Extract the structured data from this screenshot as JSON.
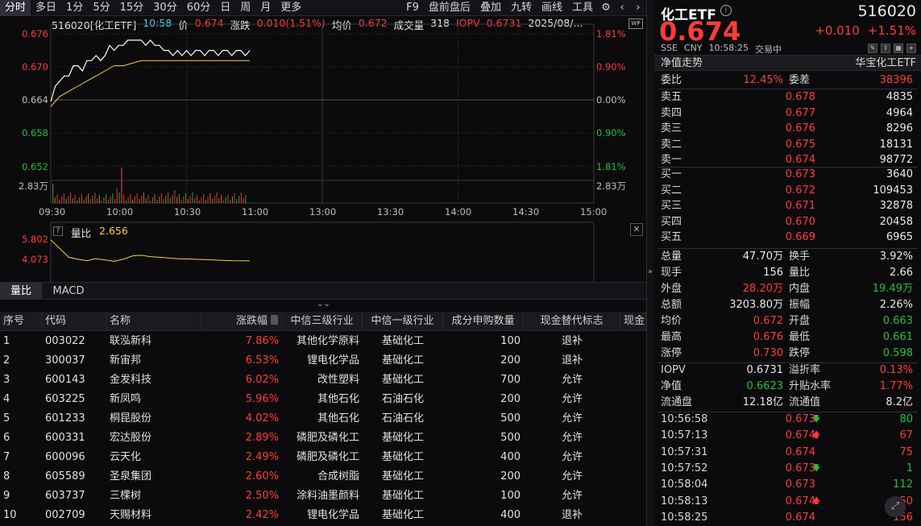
{
  "toolbar": {
    "items": [
      "分时",
      "多日",
      "1分",
      "5分",
      "15分",
      "30分",
      "60分",
      "日",
      "周",
      "月",
      "更多"
    ],
    "right_items": [
      "F9",
      "盘前盘后",
      "叠加",
      "九转",
      "画线",
      "工具"
    ]
  },
  "chart_header": {
    "code_name": "516020[化工ETF]",
    "time": "10:58",
    "price_label": "价",
    "price": "0.674",
    "change_label": "涨跌",
    "change": "0.010(1.51%)",
    "avg_label": "均价",
    "avg": "0.672",
    "volume_label": "成交量",
    "volume": "318",
    "iopv_label": "IOPV",
    "iopv": "0.6731",
    "date": "2025/08/..."
  },
  "y_axis_left": [
    "0.676",
    "0.670",
    "0.664",
    "0.658",
    "0.652"
  ],
  "y_axis_right": [
    "1.81%",
    "0.90%",
    "0.00%",
    "0.90%",
    "1.81%"
  ],
  "volume_axis": "2.83万",
  "volume_axis_right": "2.83万",
  "time_axis": [
    "09:30",
    "10:00",
    "10:30",
    "11:00",
    "13:00",
    "13:30",
    "14:00",
    "14:30",
    "15:00"
  ],
  "chart_data": {
    "type": "line",
    "ylim": [
      0.6498,
      0.6782
    ],
    "series": [
      {
        "name": "价",
        "x": [
          "09:30",
          "09:32",
          "09:34",
          "09:36",
          "09:38",
          "09:40",
          "09:42",
          "09:44",
          "09:46",
          "09:48",
          "09:50",
          "09:52",
          "09:54",
          "09:56",
          "09:58",
          "10:00",
          "10:02",
          "10:04",
          "10:06",
          "10:08",
          "10:10",
          "10:12",
          "10:14",
          "10:16",
          "10:18",
          "10:20",
          "10:22",
          "10:24",
          "10:26",
          "10:28",
          "10:30",
          "10:32",
          "10:34",
          "10:36",
          "10:38",
          "10:40",
          "10:42",
          "10:44",
          "10:46",
          "10:48",
          "10:50",
          "10:52",
          "10:54",
          "10:56",
          "10:58"
        ],
        "values": [
          0.664,
          0.667,
          0.668,
          0.669,
          0.669,
          0.671,
          0.671,
          0.67,
          0.672,
          0.672,
          0.673,
          0.672,
          0.673,
          0.675,
          0.674,
          0.675,
          0.675,
          0.676,
          0.676,
          0.676,
          0.676,
          0.675,
          0.676,
          0.675,
          0.675,
          0.674,
          0.674,
          0.673,
          0.674,
          0.673,
          0.674,
          0.673,
          0.674,
          0.674,
          0.673,
          0.674,
          0.674,
          0.673,
          0.674,
          0.674,
          0.673,
          0.674,
          0.674,
          0.673,
          0.674
        ]
      },
      {
        "name": "均价",
        "x": [
          "09:30",
          "09:34",
          "09:38",
          "09:42",
          "09:46",
          "09:50",
          "09:54",
          "09:58",
          "10:02",
          "10:06",
          "10:10",
          "10:14",
          "10:18",
          "10:22",
          "10:26",
          "10:30",
          "10:34",
          "10:38",
          "10:42",
          "10:46",
          "10:50",
          "10:54",
          "10:58"
        ],
        "values": [
          0.663,
          0.665,
          0.666,
          0.667,
          0.668,
          0.669,
          0.67,
          0.671,
          0.671,
          0.6715,
          0.672,
          0.672,
          0.672,
          0.672,
          0.672,
          0.672,
          0.672,
          0.672,
          0.672,
          0.672,
          0.672,
          0.672,
          0.672
        ]
      }
    ],
    "volume_ratio_series": {
      "ylim": [
        0,
        6.5
      ],
      "values": [
        5.802,
        4.5,
        3.2,
        2.9,
        2.7,
        3.0,
        2.8,
        2.6,
        2.9,
        3.4,
        3.5,
        3.3,
        3.2,
        3.1,
        3.0,
        2.95,
        2.9,
        2.85,
        2.8,
        2.75,
        2.7,
        2.68,
        2.656
      ]
    }
  },
  "vol_ratio_panel": {
    "help": "?",
    "label": "量比",
    "value": "2.656",
    "axis_top": "5.802",
    "axis_mid": "4.073"
  },
  "bottom_tabs": [
    "量比",
    "MACD"
  ],
  "table": {
    "headers": [
      "序号",
      "代码",
      "名称",
      "涨跌幅",
      "中信三级行业",
      "中信一级行业",
      "成分申购数量",
      "现金替代标志",
      "现金"
    ],
    "rows": [
      [
        "1",
        "003022",
        "联泓新科",
        "7.86%",
        "其他化学原料",
        "基础化工",
        "100",
        "退补"
      ],
      [
        "2",
        "300037",
        "新宙邦",
        "6.53%",
        "锂电化学品",
        "基础化工",
        "200",
        "退补"
      ],
      [
        "3",
        "600143",
        "金发科技",
        "6.02%",
        "改性塑料",
        "基础化工",
        "700",
        "允许"
      ],
      [
        "4",
        "603225",
        "新凤鸣",
        "5.96%",
        "其他石化",
        "石油石化",
        "200",
        "允许"
      ],
      [
        "5",
        "601233",
        "桐昆股份",
        "4.02%",
        "其他石化",
        "石油石化",
        "500",
        "允许"
      ],
      [
        "6",
        "600331",
        "宏达股份",
        "2.89%",
        "磷肥及磷化工",
        "基础化工",
        "500",
        "允许"
      ],
      [
        "7",
        "600096",
        "云天化",
        "2.49%",
        "磷肥及磷化工",
        "基础化工",
        "400",
        "允许"
      ],
      [
        "8",
        "605589",
        "圣泉集团",
        "2.60%",
        "合成树脂",
        "基础化工",
        "200",
        "允许"
      ],
      [
        "9",
        "603737",
        "三棵树",
        "2.50%",
        "涂料油墨颜料",
        "基础化工",
        "100",
        "允许"
      ],
      [
        "10",
        "002709",
        "天赐材料",
        "2.42%",
        "锂电化学品",
        "基础化工",
        "400",
        "退补"
      ]
    ]
  },
  "quote": {
    "name": "化工ETF",
    "info": "i",
    "code": "516020",
    "price": "0.674",
    "change": "+0.010",
    "change_pct": "+1.51%",
    "exchange": "SSE",
    "currency": "CNY",
    "time": "10:58:25",
    "status": "交易中",
    "nav_trend": "净值走势",
    "issuer": "华宝化工ETF",
    "weibi_label": "委比",
    "weibi": "12.45%",
    "weicha_label": "委差",
    "weicha": "38396"
  },
  "orderbook": {
    "asks": [
      {
        "label": "卖五",
        "price": "0.678",
        "vol": "4835"
      },
      {
        "label": "卖四",
        "price": "0.677",
        "vol": "4964"
      },
      {
        "label": "卖三",
        "price": "0.676",
        "vol": "8296"
      },
      {
        "label": "卖二",
        "price": "0.675",
        "vol": "18131"
      },
      {
        "label": "卖一",
        "price": "0.674",
        "vol": "98772"
      }
    ],
    "bids": [
      {
        "label": "买一",
        "price": "0.673",
        "vol": "3640"
      },
      {
        "label": "买二",
        "price": "0.672",
        "vol": "109453"
      },
      {
        "label": "买三",
        "price": "0.671",
        "vol": "32878"
      },
      {
        "label": "买四",
        "price": "0.670",
        "vol": "20458"
      },
      {
        "label": "买五",
        "price": "0.669",
        "vol": "6965"
      }
    ]
  },
  "stats": [
    {
      "k1": "总量",
      "v1": "47.70万",
      "c1": "w",
      "k2": "换手",
      "v2": "3.92%",
      "c2": "w"
    },
    {
      "k1": "现手",
      "v1": "156",
      "c1": "w",
      "k2": "量比",
      "v2": "2.66",
      "c2": "w"
    },
    {
      "k1": "外盘",
      "v1": "28.20万",
      "c1": "r",
      "k2": "内盘",
      "v2": "19.49万",
      "c2": "g"
    },
    {
      "k1": "总额",
      "v1": "3203.80万",
      "c1": "w",
      "k2": "振幅",
      "v2": "2.26%",
      "c2": "w"
    },
    {
      "k1": "均价",
      "v1": "0.672",
      "c1": "r",
      "k2": "开盘",
      "v2": "0.663",
      "c2": "g"
    },
    {
      "k1": "最高",
      "v1": "0.676",
      "c1": "r",
      "k2": "最低",
      "v2": "0.661",
      "c2": "g"
    },
    {
      "k1": "涨停",
      "v1": "0.730",
      "c1": "r",
      "k2": "跌停",
      "v2": "0.598",
      "c2": "g"
    }
  ],
  "stats2": [
    {
      "k1": "IOPV",
      "v1": "0.6731",
      "c1": "w",
      "k2": "溢折率",
      "v2": "0.13%",
      "c2": "r"
    },
    {
      "k1": "净值",
      "v1": "0.6623",
      "c1": "g",
      "k2": "升贴水率",
      "v2": "1.77%",
      "c2": "r"
    },
    {
      "k1": "流通盘",
      "v1": "12.18亿",
      "c1": "w",
      "k2": "流通值",
      "v2": "8.2亿",
      "c2": "w"
    }
  ],
  "trades": [
    {
      "t": "10:56:58",
      "p": "0.673",
      "pc": "r",
      "arrow": "down",
      "v": "80",
      "vc": "g"
    },
    {
      "t": "10:57:13",
      "p": "0.674",
      "pc": "r",
      "arrow": "up",
      "v": "67",
      "vc": "r"
    },
    {
      "t": "10:57:31",
      "p": "0.674",
      "pc": "r",
      "arrow": "",
      "v": "75",
      "vc": "r"
    },
    {
      "t": "10:57:52",
      "p": "0.673",
      "pc": "r",
      "arrow": "down",
      "v": "1",
      "vc": "g"
    },
    {
      "t": "10:58:04",
      "p": "0.673",
      "pc": "r",
      "arrow": "",
      "v": "112",
      "vc": "g"
    },
    {
      "t": "10:58:13",
      "p": "0.674",
      "pc": "r",
      "arrow": "up",
      "v": "50",
      "vc": "r"
    },
    {
      "t": "10:58:25",
      "p": "0.674",
      "pc": "r",
      "arrow": "",
      "v": "156",
      "vc": "r"
    }
  ],
  "colors": {
    "up": "#ff3b3b",
    "down": "#22c03a",
    "price_line": "#ffffff",
    "avg_line": "#f5d23a"
  }
}
